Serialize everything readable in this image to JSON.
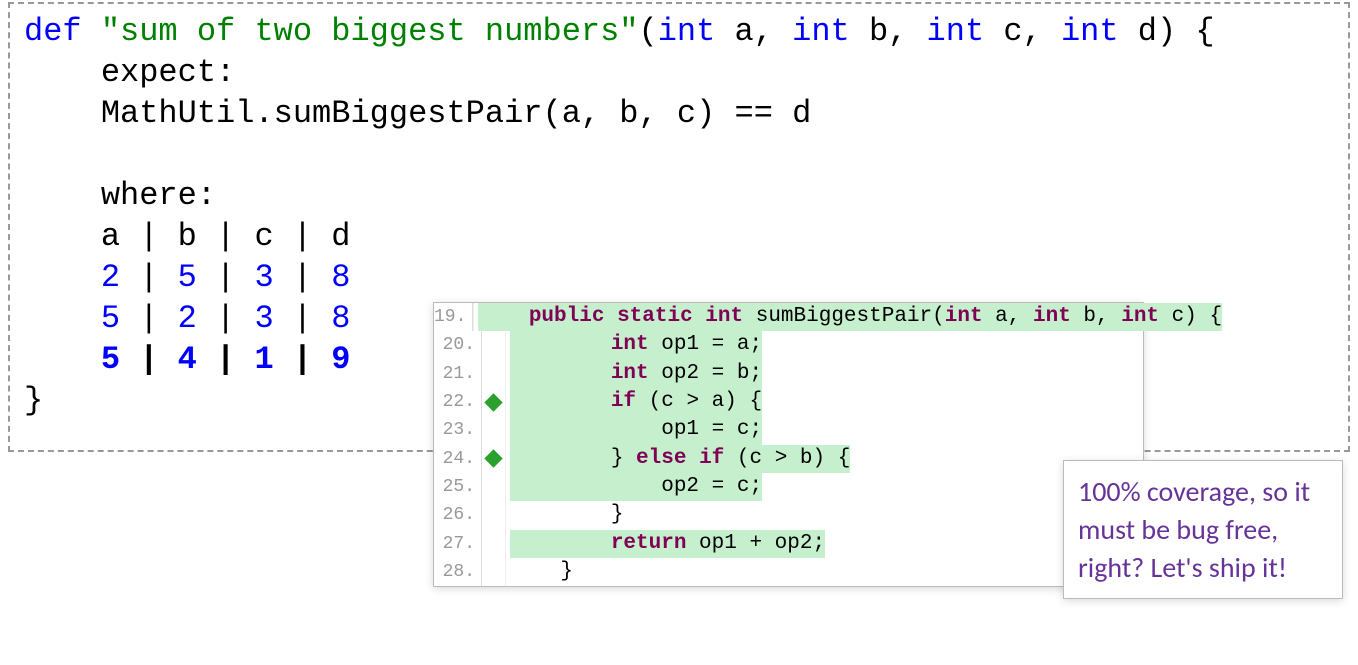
{
  "test": {
    "def": "def",
    "name": "\"sum of two biggest numbers\"",
    "params_open": "(",
    "t1": "int",
    "p1": " a, ",
    "t2": "int",
    "p2": " b, ",
    "t3": "int",
    "p3": " c, ",
    "t4": "int",
    "p4": " d) {",
    "expect": "    expect:",
    "call": "    MathUtil.sumBiggestPair(a, b, c) == d",
    "where": "    where:",
    "header": "    a | b | c | d",
    "row1_a": "2",
    "row1_b": "5",
    "row1_c": "3",
    "row1_d": "8",
    "row2_a": "5",
    "row2_b": "2",
    "row2_c": "3",
    "row2_d": "8",
    "row3_a": "5",
    "row3_b": "4",
    "row3_c": "1",
    "row3_d": "9",
    "close": "}"
  },
  "ide": {
    "lines": {
      "19": {
        "n": "19."
      },
      "20": {
        "n": "20."
      },
      "21": {
        "n": "21."
      },
      "22": {
        "n": "22."
      },
      "23": {
        "n": "23."
      },
      "24": {
        "n": "24."
      },
      "25": {
        "n": "25."
      },
      "26": {
        "n": "26."
      },
      "27": {
        "n": "27."
      },
      "28": {
        "n": "28."
      }
    },
    "kw_public": "public",
    "kw_static": "static",
    "kw_int": "int",
    "kw_if": "if",
    "kw_else": "else",
    "kw_return": "return",
    "l19_name": " sumBiggestPair(",
    "l19_pa": " a, ",
    "l19_pb": " b, ",
    "l19_pc": " c) {",
    "l20_rest": " op1 = a;",
    "l21_rest": " op2 = b;",
    "l22_cond": " (c > a) {",
    "l23": "            op1 = c;",
    "l24_mid": " (c > b) {",
    "l24_close": "        } ",
    "l25": "            op2 = c;",
    "l26": "        }",
    "l27_rest": " op1 + op2;",
    "l28": "    }",
    "ind8": "        ",
    "sp": " "
  },
  "callout": {
    "text": "100% coverage, so it must be bug free, right? Let's ship it!"
  }
}
